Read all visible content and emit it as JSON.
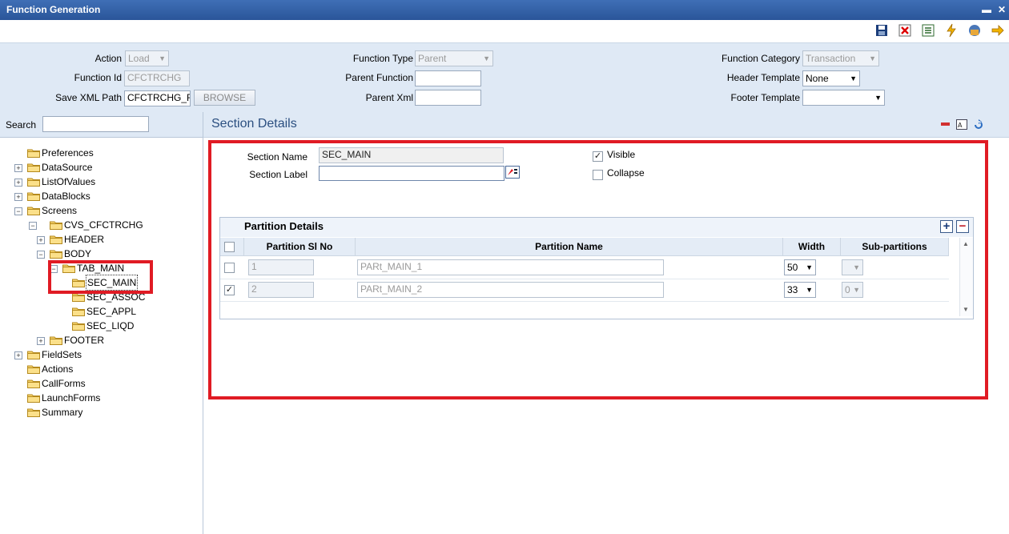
{
  "window": {
    "title": "Function Generation",
    "min_glyph": "▬",
    "close_glyph": "✕"
  },
  "toolbar": {
    "icons": [
      "save-icon",
      "delete-icon",
      "list-icon",
      "generate-icon",
      "deploy-icon",
      "exit-icon"
    ]
  },
  "header": {
    "action": {
      "label": "Action",
      "value": "Load"
    },
    "function_id": {
      "label": "Function Id",
      "value": "CFCTRCHG"
    },
    "save_xml_path": {
      "label": "Save XML Path",
      "value": "CFCTRCHG_F",
      "browse_label": "BROWSE"
    },
    "function_type": {
      "label": "Function Type",
      "value": "Parent"
    },
    "parent_function": {
      "label": "Parent Function",
      "value": ""
    },
    "parent_xml": {
      "label": "Parent Xml",
      "value": ""
    },
    "function_category": {
      "label": "Function Category",
      "value": "Transaction"
    },
    "header_template": {
      "label": "Header Template",
      "value": "None"
    },
    "footer_template": {
      "label": "Footer Template",
      "value": ""
    }
  },
  "search": {
    "label": "Search",
    "value": ""
  },
  "tree": [
    {
      "label": "Preferences"
    },
    {
      "label": "DataSource"
    },
    {
      "label": "ListOfValues"
    },
    {
      "label": "DataBlocks"
    },
    {
      "label": "Screens"
    },
    {
      "label": "CVS_CFCTRCHG"
    },
    {
      "label": "HEADER"
    },
    {
      "label": "BODY"
    },
    {
      "label": "TAB_MAIN"
    },
    {
      "label": "SEC_MAIN"
    },
    {
      "label": "SEC_ASSOC"
    },
    {
      "label": "SEC_APPL"
    },
    {
      "label": "SEC_LIQD"
    },
    {
      "label": "FOOTER"
    },
    {
      "label": "FieldSets"
    },
    {
      "label": "Actions"
    },
    {
      "label": "CallForms"
    },
    {
      "label": "LaunchForms"
    },
    {
      "label": "Summary"
    }
  ],
  "section": {
    "title": "Section Details",
    "section_name": {
      "label": "Section Name",
      "value": "SEC_MAIN"
    },
    "section_label": {
      "label": "Section Label",
      "value": ""
    },
    "visible": {
      "label": "Visible",
      "checked": true,
      "check_glyph": "✓"
    },
    "collapse": {
      "label": "Collapse",
      "checked": false
    }
  },
  "partition": {
    "title": "Partition Details",
    "add_glyph": "+",
    "remove_glyph": "−",
    "columns": [
      "Partition Sl No",
      "Partition Name",
      "Width",
      "Sub-partitions"
    ],
    "rows": [
      {
        "checked": false,
        "sl_no": "1",
        "name": "PARt_MAIN_1",
        "width": "50",
        "sub": "",
        "check_glyph": ""
      },
      {
        "checked": true,
        "sl_no": "2",
        "name": "PARt_MAIN_2",
        "width": "33",
        "sub": "0",
        "check_glyph": "✓"
      }
    ]
  },
  "colors": {
    "header_bg": "#dfe9f5",
    "title_bg": "#2a5599",
    "highlight": "#e01b24"
  }
}
